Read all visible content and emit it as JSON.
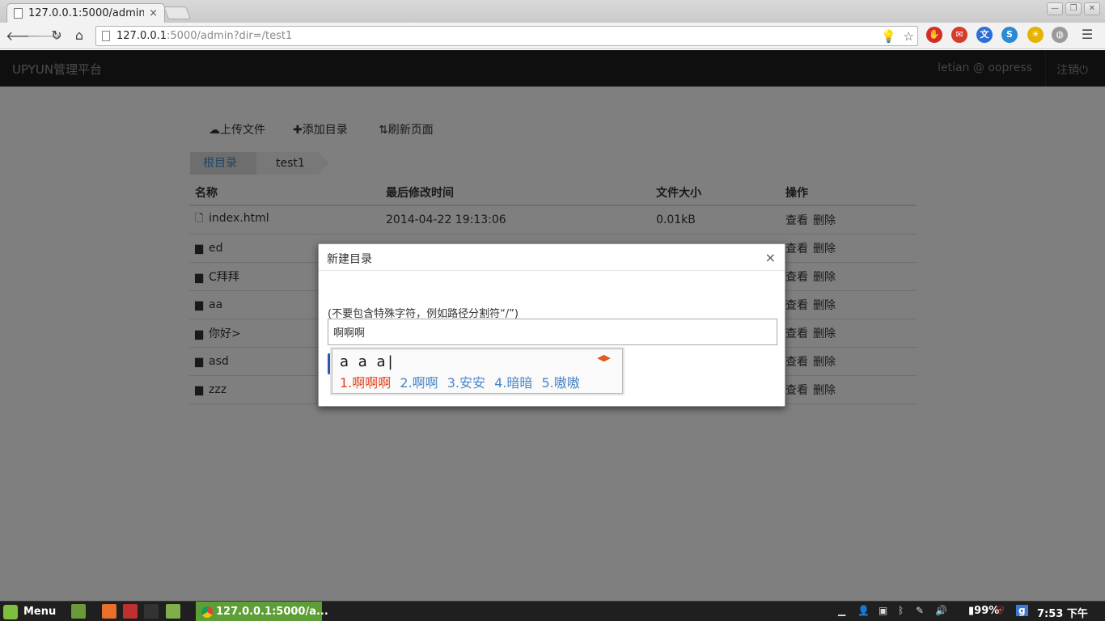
{
  "browser": {
    "tab_title": "127.0.0.1:5000/admin",
    "tab_close": "×",
    "url_host": "127.0.0.1",
    "url_rest": ":5000/admin?dir=/test1",
    "window_controls": [
      "—",
      "❐",
      "✕"
    ],
    "nav_icons": [
      "arrow-left-icon",
      "arrow-right-icon",
      "reload-icon",
      "home-icon"
    ],
    "extensions": [
      {
        "name": "adblock-icon",
        "color": "#d62b2b",
        "glyph": "✋",
        "badge": ""
      },
      {
        "name": "gmail-icon",
        "color": "#d63b2b",
        "glyph": "✉",
        "badge": "3"
      },
      {
        "name": "translate-icon",
        "color": "#2b6fd6",
        "glyph": "文",
        "badge": ""
      },
      {
        "name": "dictionary-icon",
        "color": "#2b8ad6",
        "glyph": "S",
        "badge": ""
      },
      {
        "name": "weather-icon",
        "color": "#e6b200",
        "glyph": "☀",
        "badge": "17°"
      },
      {
        "name": "globe-icon",
        "color": "#9a9a9a",
        "glyph": "◍",
        "badge": ""
      }
    ],
    "menu_glyph": "☰"
  },
  "navbar": {
    "brand": "UPYUN管理平台",
    "user": "letian @ oopress",
    "logout": "注销⏻"
  },
  "actions": {
    "upload": "上传文件",
    "add_dir": "添加目录",
    "refresh": "刷新页面"
  },
  "breadcrumb": {
    "root": "根目录",
    "current": "test1"
  },
  "table": {
    "headers": [
      "名称",
      "最后修改时间",
      "文件大小",
      "操作"
    ],
    "rows": [
      {
        "type": "file",
        "name": "index.html",
        "modified": "2014-04-22 19:13:06",
        "size": "0.01kB"
      },
      {
        "type": "folder",
        "name": "ed",
        "modified": "",
        "size": ""
      },
      {
        "type": "folder",
        "name": "C拜拜",
        "modified": "",
        "size": ""
      },
      {
        "type": "folder",
        "name": "aa",
        "modified": "",
        "size": ""
      },
      {
        "type": "folder",
        "name": "你好>",
        "modified": "",
        "size": ""
      },
      {
        "type": "folder",
        "name": "asd",
        "modified": "",
        "size": ""
      },
      {
        "type": "folder",
        "name": "zzz",
        "modified": "",
        "size": ""
      }
    ],
    "op_view": "查看",
    "op_delete": "删除"
  },
  "modal": {
    "title": "新建目录",
    "close": "×",
    "hint": "(不要包含特殊字符，例如路径分割符“/”)",
    "input_value": "啊啊啊"
  },
  "ime": {
    "composition": "a a a|",
    "arrows": "◀▶",
    "candidates": [
      "1.啊啊啊",
      "2.啊啊",
      "3.安安",
      "4.暗暗",
      "5.嗷嗷"
    ]
  },
  "taskbar": {
    "menu": "Menu",
    "task_title": "127.0.0.1:5000/a...",
    "battery": "99%",
    "clock": "7:53 下午",
    "launchers": [
      {
        "name": "desktop-icon",
        "color": "#6a9a3a"
      },
      {
        "name": "firefox-icon",
        "color": "#e8702a"
      },
      {
        "name": "app-grid-icon",
        "color": "#c03030"
      },
      {
        "name": "terminal-icon",
        "color": "#333333"
      },
      {
        "name": "files-icon",
        "color": "#7fae4a"
      }
    ]
  }
}
